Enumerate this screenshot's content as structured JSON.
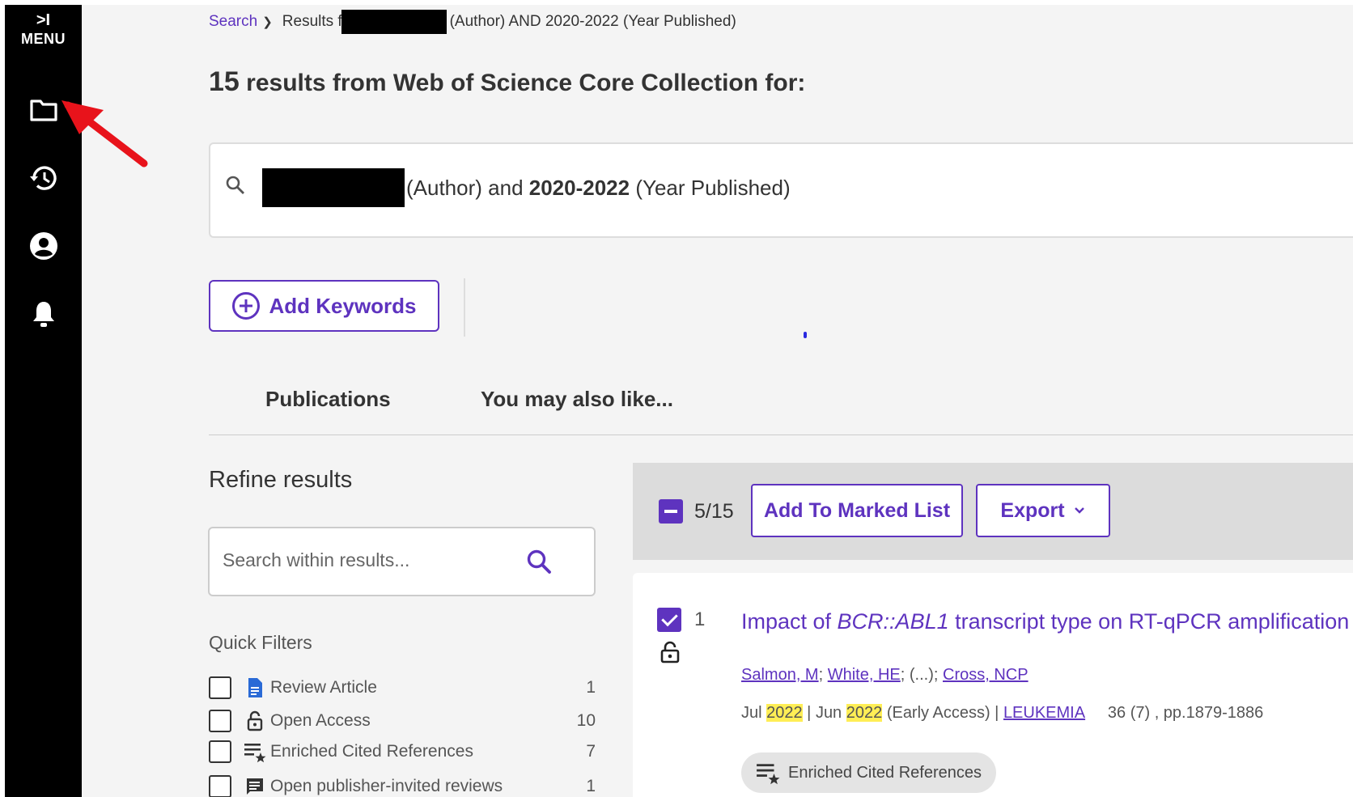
{
  "sidebar": {
    "menu_label": "MENU",
    "menu_chevron": ">I",
    "icons": [
      "folder-icon",
      "history-icon",
      "account-icon",
      "bell-icon"
    ]
  },
  "breadcrumb": {
    "search_label": "Search",
    "results_prefix": "Results for",
    "results_suffix": "(Author) AND 2020-2022 (Year Published)"
  },
  "results_header": {
    "count": "15",
    "text": "results from Web of Science Core Collection for:"
  },
  "query": {
    "author_suffix": "(Author) and",
    "years": "2020-2022",
    "year_suffix": "(Year Published)"
  },
  "add_keywords_label": "Add Keywords",
  "tabs": {
    "publications": "Publications",
    "also_like": "You may also like..."
  },
  "refine": {
    "title": "Refine results",
    "search_placeholder": "Search within results...",
    "quick_filters_title": "Quick Filters",
    "filters": [
      {
        "label": "Review Article",
        "count": "1",
        "icon": "document-icon"
      },
      {
        "label": "Open Access",
        "count": "10",
        "icon": "open-lock-icon"
      },
      {
        "label": "Enriched Cited References",
        "count": "7",
        "icon": "enriched-list-icon"
      },
      {
        "label": "Open publisher-invited reviews",
        "count": "1",
        "icon": "comment-icon"
      }
    ]
  },
  "toolbar": {
    "selected": "5/15",
    "add_marked": "Add To Marked List",
    "export": "Export"
  },
  "result1": {
    "num": "1",
    "title_pre": "Impact of ",
    "title_ital": "BCR::ABL1",
    "title_post": " transcript type on RT-qPCR amplification pe",
    "authors": [
      "Salmon, M",
      "White, HE",
      "Cross, NCP"
    ],
    "ellipsis": "(...)",
    "date1_month": "Jul ",
    "date1_year": "2022",
    "date2_month": "Jun ",
    "date2_year": "2022",
    "early_access": "(Early Access)",
    "journal": "LEUKEMIA",
    "volume": "36 (7) , pp.1879-1886",
    "pill": "Enriched Cited References"
  },
  "colors": {
    "accent": "#5e33bf",
    "sidebar": "#000000",
    "highlight": "#ffee55",
    "annotation": "#e8131b"
  }
}
